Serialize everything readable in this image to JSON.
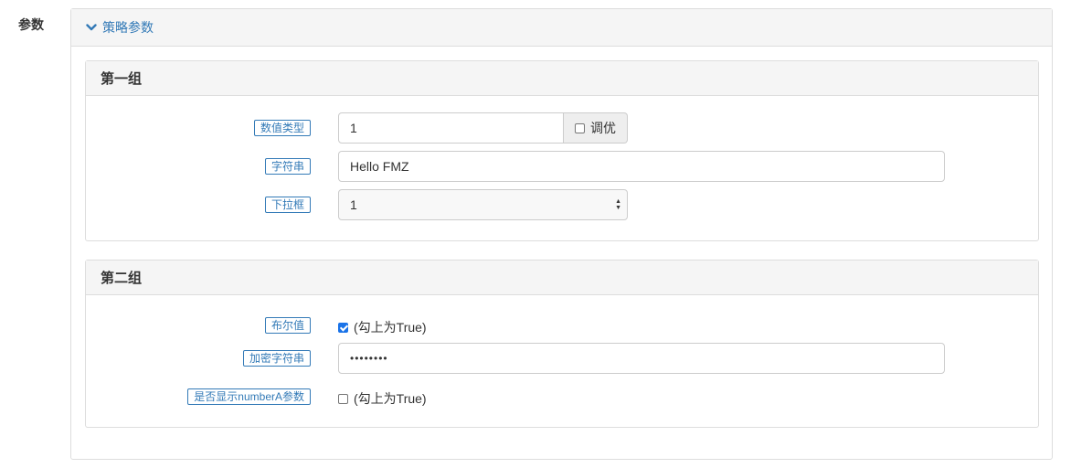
{
  "side_label": "参数",
  "panel": {
    "title": "策略参数",
    "icon": "chevron-down-icon"
  },
  "groups": [
    {
      "title": "第一组",
      "fields": [
        {
          "label": "数值类型",
          "value": "1",
          "addon_label": "调优",
          "addon_checked": false
        },
        {
          "label": "字符串",
          "value": "Hello FMZ"
        },
        {
          "label": "下拉框",
          "value": "1"
        }
      ]
    },
    {
      "title": "第二组",
      "fields": [
        {
          "label": "布尔值",
          "checked": true,
          "text": "(勾上为True)"
        },
        {
          "label": "加密字符串",
          "value": "••••••••"
        },
        {
          "label": "是否显示numberA参数",
          "checked": false,
          "text": "(勾上为True)"
        }
      ]
    }
  ],
  "colors": {
    "accent": "#337ab7",
    "checkbox": "#1a73e8",
    "header_bg": "#f5f5f5",
    "border": "#dddddd"
  }
}
